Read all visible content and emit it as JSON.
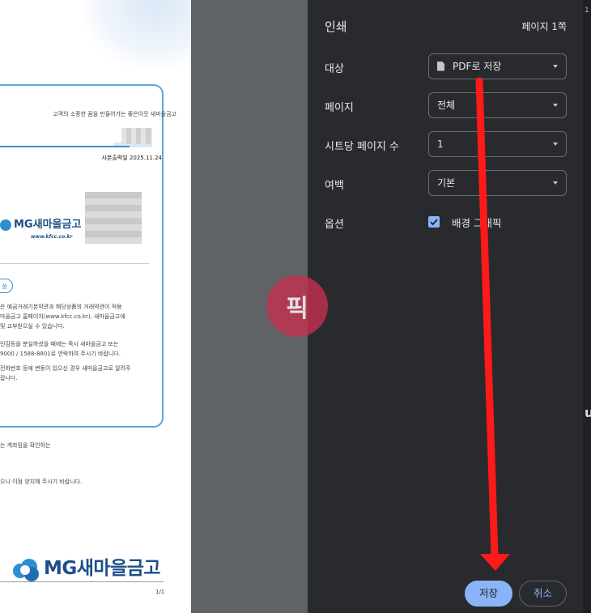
{
  "preview": {
    "slogan": "고객의 소중한 꿈을 만들어가는 좋은이웃 새마을금고",
    "print_date": "사본출력일  2025.11.24",
    "logo_small": "MG새마을금고",
    "logo_url": "www.kfcc.co.kr",
    "pill_text": "쏨",
    "paragraph1": [
      "은 예금거래기본약관과 해당상품의 거래약관이 적용",
      "마을금고 홈페이지(www.kfcc.co.kr), 새마을금고에",
      "및 교부받으실 수 있습니다."
    ],
    "paragraph2": [
      "인감등을 분실하셨을 때에는 즉시 새마을금고 또는",
      "9000 / 1588-8801로 연락하여 주시기 바랍니다."
    ],
    "paragraph3": [
      "전화번호 등에 변동이 있으신 경우 새마을금고로 알려주",
      "랍니다."
    ],
    "below_text1": "는 계좌임을 확인하는",
    "below_text2": "으니 이점 양지해 주시기 바랍니다.",
    "logo_big": "MG새마을금고",
    "page_number": "1/1"
  },
  "watermark": "픽",
  "dialog": {
    "title": "인쇄",
    "page_count": "페이지 1쪽",
    "destination": {
      "label": "대상",
      "value": "PDF로 저장"
    },
    "pages": {
      "label": "페이지",
      "value": "전체"
    },
    "pages_per_sheet": {
      "label": "시트당 페이지 수",
      "value": "1"
    },
    "margins": {
      "label": "여백",
      "value": "기본"
    },
    "options": {
      "label": "옵션",
      "checkbox_label": "배경 그래픽",
      "checked": true
    },
    "save_button": "저장",
    "cancel_button": "취소"
  },
  "right_strip": [
    "1",
    "u"
  ],
  "colors": {
    "accent": "#8ab4f8",
    "dialog_bg": "#292a2d",
    "arrow": "#ff1a1a",
    "watermark": "#c2304f"
  }
}
